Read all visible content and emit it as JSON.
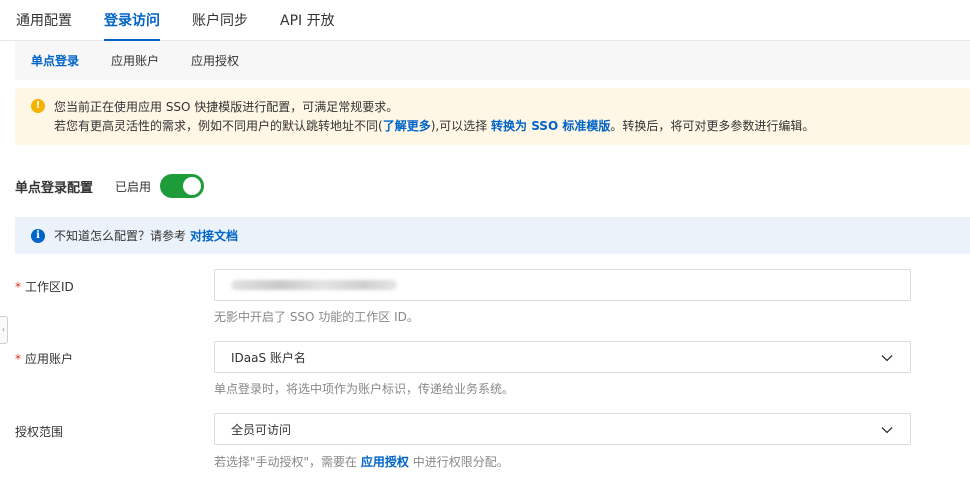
{
  "top_tabs": [
    {
      "label": "通用配置"
    },
    {
      "label": "登录访问"
    },
    {
      "label": "账户同步"
    },
    {
      "label": "API 开放"
    }
  ],
  "sub_tabs": [
    {
      "label": "单点登录"
    },
    {
      "label": "应用账户"
    },
    {
      "label": "应用授权"
    }
  ],
  "warning": {
    "icon": "warning-icon",
    "line1": "您当前正在使用应用 SSO 快捷模版进行配置，可满足常规要求。",
    "line2_pre": "若您有更高灵活性的需求，例如不同用户的默认跳转地址不同(",
    "learn_more": "了解更多",
    "line2_mid": "),可以选择 ",
    "convert_link": "转换为 SSO 标准模版",
    "line2_post": "。转换后，将可对更多参数进行编辑。"
  },
  "sso": {
    "title": "单点登录配置",
    "status": "已启用",
    "enabled": true
  },
  "info": {
    "icon": "info-icon",
    "text": "不知道怎么配置？请参考",
    "link": "对接文档"
  },
  "form": {
    "workspace_id": {
      "label": "工作区ID",
      "required": true,
      "help": "无影中开启了 SSO 功能的工作区 ID。"
    },
    "app_account": {
      "label": "应用账户",
      "required": true,
      "value": "IDaaS 账户名",
      "help": "单点登录时，将选中项作为账户标识，传递给业务系统。"
    },
    "scope": {
      "label": "授权范围",
      "value": "全员可访问",
      "help_pre": "若选择\"手动授权\"，需要在 ",
      "help_link": "应用授权",
      "help_post": " 中进行权限分配。"
    }
  },
  "colors": {
    "accent": "#0064c8",
    "toggle_on": "#1f9c3a",
    "warning_bg": "#fff7e6",
    "info_bg": "#ebf2fa",
    "required": "#d93026"
  }
}
